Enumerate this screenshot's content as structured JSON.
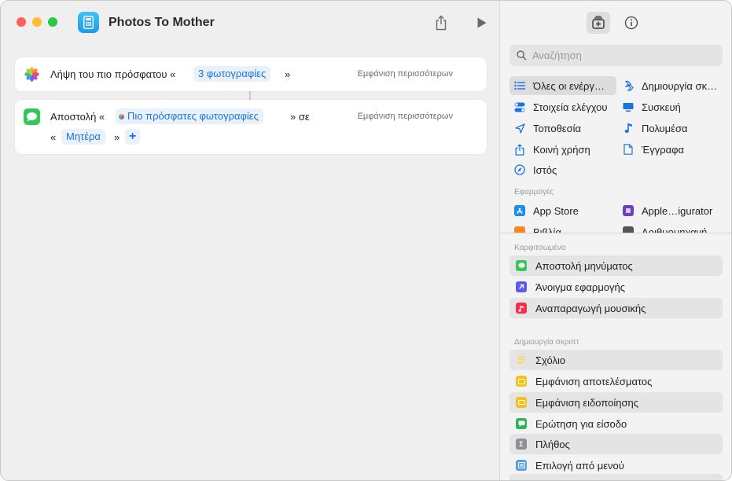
{
  "window": {
    "title": "Photos To Mother"
  },
  "colors": {
    "close": "#fe5f57",
    "minimize": "#febc2e",
    "zoom": "#28c840",
    "accent": "#1a73e2"
  },
  "workflow": {
    "action1": {
      "prefix": "Λήψη του πιο πρόσφατου «",
      "token": "3 φωτογραφίες",
      "suffix": "»",
      "more": "Εμφάνιση περισσότερων",
      "icon": "photos-icon"
    },
    "action2": {
      "prefix": "Αποστολή «",
      "token": "Πιο πρόσφατες φωτογραφίες",
      "middle": "» σε",
      "open2": "«",
      "recipient": "Μητέρα",
      "close2": "»",
      "add": "+",
      "more": "Εμφάνιση περισσότερων",
      "icon": "messages-icon"
    }
  },
  "sidebar": {
    "search_placeholder": "Αναζήτηση",
    "categories": [
      {
        "label": "Όλες οι ενέργ…",
        "icon": "list-icon"
      },
      {
        "label": "Δημιουργία σκ…",
        "icon": "scripting-icon"
      },
      {
        "label": "Στοιχεία ελέγχου",
        "icon": "controls-icon"
      },
      {
        "label": "Συσκευή",
        "icon": "device-icon"
      },
      {
        "label": "Τοποθεσία",
        "icon": "location-icon"
      },
      {
        "label": "Πολυμέσα",
        "icon": "music-note-icon"
      },
      {
        "label": "Κοινή χρήση",
        "icon": "share-icon"
      },
      {
        "label": "Έγγραφα",
        "icon": "document-icon"
      },
      {
        "label": "Ιστός",
        "icon": "compass-icon"
      }
    ],
    "apps_header": "Εφαρμογές",
    "apps": [
      {
        "label": "App Store",
        "icon": "app-store-icon"
      },
      {
        "label": "Apple…igurator",
        "icon": "configurator-icon"
      },
      {
        "label": "Βιβλία",
        "icon": "books-icon"
      },
      {
        "label": "Αριθμομηχανή",
        "icon": "calculator-icon"
      }
    ],
    "pinned_header": "Καρφιτσωμένα",
    "pinned": [
      {
        "label": "Αποστολή μηνύματος",
        "color": "#34c759",
        "icon": "message-icon"
      },
      {
        "label": "Άνοιγμα εφαρμογής",
        "color": "#5e5ce6",
        "icon": "open-app-icon"
      },
      {
        "label": "Αναπαραγωγή μουσικής",
        "color": "#fa2d48",
        "icon": "music-icon"
      }
    ],
    "scripting_header": "Δημιουργία σκριπτ",
    "scripting": [
      {
        "label": "Σχόλιο",
        "color": "#f4d64a",
        "icon": "comment-icon"
      },
      {
        "label": "Εμφάνιση αποτελέσματος",
        "color": "#f5c21b",
        "icon": "show-result-icon"
      },
      {
        "label": "Εμφάνιση ειδοποίησης",
        "color": "#f5c21b",
        "icon": "alert-icon"
      },
      {
        "label": "Ερώτηση για είσοδο",
        "color": "#2fb457",
        "icon": "ask-input-icon"
      },
      {
        "label": "Πλήθος",
        "color": "#8e8e93",
        "icon": "count-icon"
      },
      {
        "label": "Επιλογή από μενού",
        "color": "#5aa0e8",
        "icon": "menu-icon"
      }
    ]
  }
}
